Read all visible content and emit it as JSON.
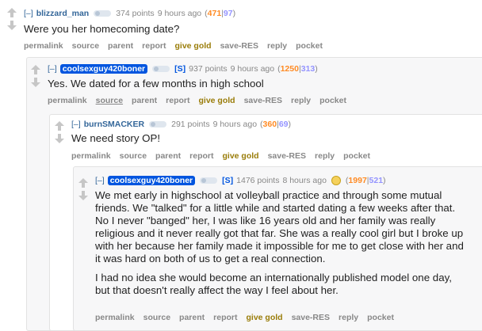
{
  "comments": [
    {
      "expand": "[–]",
      "author": "blizzard_man",
      "points": "374 points",
      "age": "9 hours ago",
      "ups": "471",
      "downs": "97",
      "body": [
        "Were you her homecoming date?"
      ],
      "actions": [
        "permalink",
        "source",
        "parent",
        "report",
        "give gold",
        "save-RES",
        "reply",
        "pocket"
      ]
    },
    {
      "expand": "[–]",
      "author": "coolsexguy420boner",
      "submitter": "[S]",
      "points": "937 points",
      "age": "9 hours ago",
      "ups": "1250",
      "downs": "313",
      "body": [
        "Yes. We dated for a few months in high school"
      ],
      "actions": [
        "permalink",
        "source",
        "parent",
        "report",
        "give gold",
        "save-RES",
        "reply",
        "pocket"
      ]
    },
    {
      "expand": "[–]",
      "author": "burnSMACKER",
      "points": "291 points",
      "age": "9 hours ago",
      "ups": "360",
      "downs": "69",
      "body": [
        "We need story OP!"
      ],
      "actions": [
        "permalink",
        "source",
        "parent",
        "report",
        "give gold",
        "save-RES",
        "reply",
        "pocket"
      ]
    },
    {
      "expand": "[–]",
      "author": "coolsexguy420boner",
      "submitter": "[S]",
      "points": "1476 points",
      "age": "8 hours ago",
      "ups": "1997",
      "downs": "521",
      "body": [
        "We met early in highschool at volleyball practice and through some mutual friends. We \"talked\" for a little while and started dating a few weeks after that. No I never \"banged\" her, I was like 16 years old and her family was really religious and it never really got that far. She was a really cool girl but I broke up with her because her family made it impossible for me to get close with her and it was hard on both of us to get a real connection.",
        "I had no idea she would become an internationally published model one day, but that doesn't really affect the way I feel about her."
      ],
      "actions": [
        "permalink",
        "source",
        "parent",
        "report",
        "give gold",
        "save-RES",
        "reply",
        "pocket"
      ]
    }
  ],
  "colors": {
    "upvotes": "#ff8b24",
    "downvotes": "#9494ff",
    "author": "#336699",
    "op_badge": "#0055df"
  }
}
